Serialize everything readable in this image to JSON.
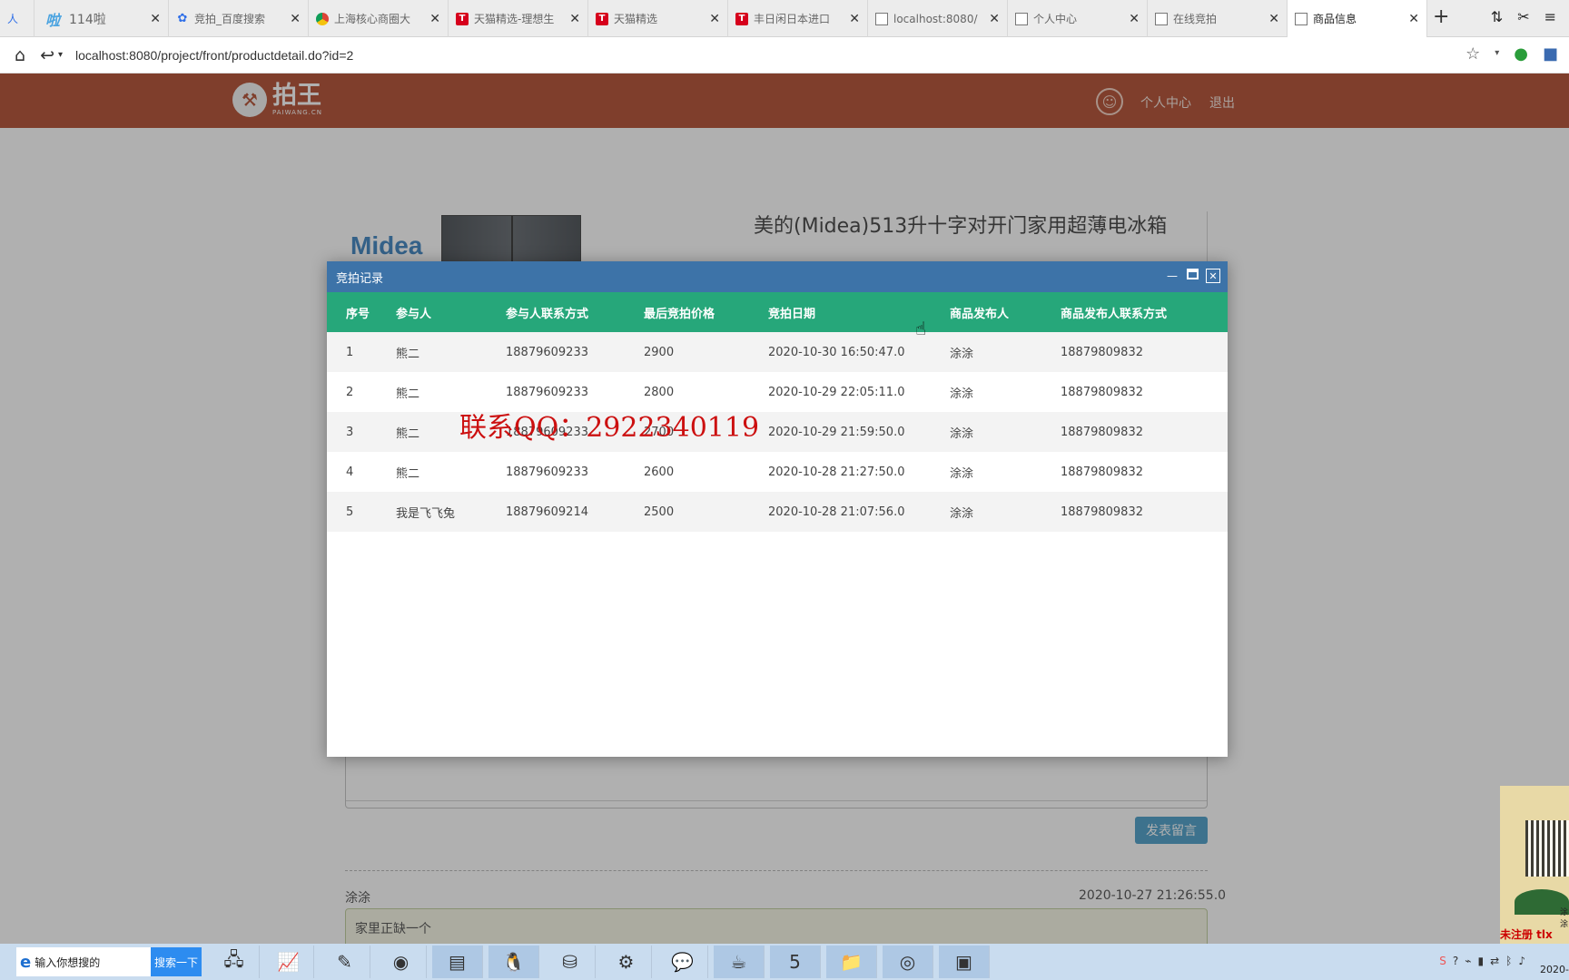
{
  "browser": {
    "tabs": [
      {
        "title": "人",
        "icon": "none-icon",
        "active": false
      },
      {
        "title": "114啦",
        "icon": "la-icon",
        "active": false
      },
      {
        "title": "竞拍_百度搜索",
        "icon": "baidu-paw-icon",
        "active": false
      },
      {
        "title": "上海核心商圈大",
        "icon": "chrome-icon",
        "active": false
      },
      {
        "title": "天猫精选-理想生",
        "icon": "tmall-icon",
        "active": false
      },
      {
        "title": "天猫精选",
        "icon": "tmall-icon",
        "active": false
      },
      {
        "title": "丰日闲日本进口",
        "icon": "tmall-icon",
        "active": false
      },
      {
        "title": "localhost:8080/",
        "icon": "page-icon",
        "active": false
      },
      {
        "title": "个人中心",
        "icon": "page-icon",
        "active": false
      },
      {
        "title": "在线竞拍",
        "icon": "page-icon",
        "active": false
      },
      {
        "title": "商品信息",
        "icon": "page-icon",
        "active": true
      }
    ],
    "url": "localhost:8080/project/front/productdetail.do?id=2"
  },
  "header": {
    "logo_text": "拍王",
    "logo_sub": "PAIWANG.CN",
    "personal_center": "个人中心",
    "logout": "退出"
  },
  "product": {
    "brand": "Midea",
    "title": "美的(Midea)513升十字对开门家用超薄电冰箱"
  },
  "dialog": {
    "title": "竞拍记录",
    "columns": [
      "序号",
      "参与人",
      "参与人联系方式",
      "最后竞拍价格",
      "竞拍日期",
      "商品发布人",
      "商品发布人联系方式"
    ],
    "rows": [
      [
        "1",
        "熊二",
        "18879609233",
        "2900",
        "2020-10-30 16:50:47.0",
        "涂涂",
        "18879809832"
      ],
      [
        "2",
        "熊二",
        "18879609233",
        "2800",
        "2020-10-29 22:05:11.0",
        "涂涂",
        "18879809832"
      ],
      [
        "3",
        "熊二",
        "18879609233",
        "2700",
        "2020-10-29 21:59:50.0",
        "涂涂",
        "18879809832"
      ],
      [
        "4",
        "熊二",
        "18879609233",
        "2600",
        "2020-10-28 21:27:50.0",
        "涂涂",
        "18879809832"
      ],
      [
        "5",
        "我是飞飞兔",
        "18879609214",
        "2500",
        "2020-10-28 21:07:56.0",
        "涂涂",
        "18879809832"
      ]
    ]
  },
  "watermark": "联系QQ：2922340119",
  "comments": {
    "post_button": "发表留言",
    "items": [
      {
        "user": "涂涂",
        "time": "2020-10-27 21:26:55.0",
        "text": "家里正缺一个"
      }
    ]
  },
  "qr_widget": {
    "label": "涂涂",
    "red_text": "未注册 tlx"
  },
  "taskbar": {
    "search_placeholder": "输入你想搜的",
    "search_button": "搜索一下",
    "clock": "2020-"
  },
  "colors": {
    "header_bg": "#a7310f",
    "dialog_title_bg": "#3d73a8",
    "table_header_bg": "#26a77a",
    "post_button_bg": "#2f8fbf"
  }
}
